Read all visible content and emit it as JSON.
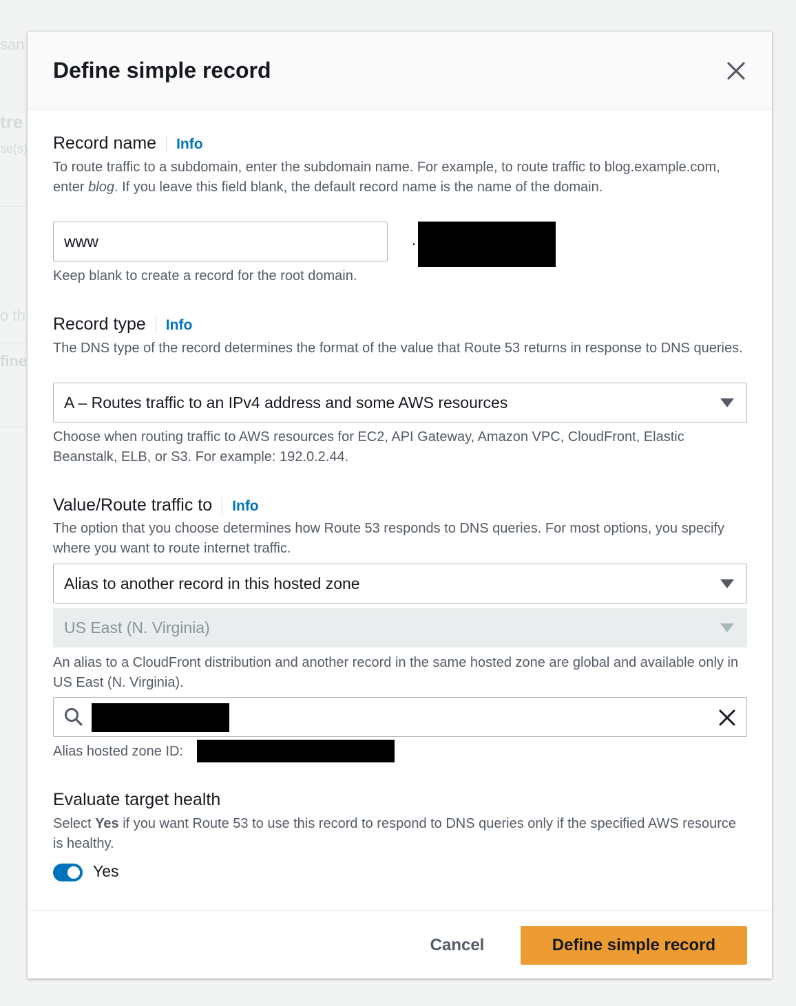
{
  "background": {
    "fragments": [
      "san",
      "tre",
      "se(s)",
      "o th",
      "fine"
    ]
  },
  "modal": {
    "title": "Define simple record",
    "close_icon": "close-icon"
  },
  "record_name": {
    "label": "Record name",
    "info": "Info",
    "description_part1": "To route traffic to a subdomain, enter the subdomain name. For example, to route traffic to blog.example.com, enter ",
    "description_em": "blog",
    "description_part2": ". If you leave this field blank, the default record name is the name of the domain.",
    "value": "www",
    "separator": ".",
    "hint": "Keep blank to create a record for the root domain."
  },
  "record_type": {
    "label": "Record type",
    "info": "Info",
    "description": "The DNS type of the record determines the format of the value that Route 53 returns in response to DNS queries.",
    "selected": "A – Routes traffic to an IPv4 address and some AWS resources",
    "hint": "Choose when routing traffic to AWS resources for EC2, API Gateway, Amazon VPC, CloudFront, Elastic Beanstalk, ELB, or S3. For example: 192.0.2.44."
  },
  "value_route": {
    "label": "Value/Route traffic to",
    "info": "Info",
    "description": "The option that you choose determines how Route 53 responds to DNS queries. For most options, you specify where you want to route internet traffic.",
    "endpoint_selected": "Alias to another record in this hosted zone",
    "region_selected": "US East (N. Virginia)",
    "region_hint": "An alias to a CloudFront distribution and another record in the same hosted zone are global and available only in US East (N. Virginia).",
    "search_icon": "search-icon",
    "alias_zone_label": "Alias hosted zone ID:"
  },
  "evaluate_health": {
    "label": "Evaluate target health",
    "description_pre": "Select ",
    "description_bold": "Yes",
    "description_post": " if you want Route 53 to use this record to respond to DNS queries only if the specified AWS resource is healthy.",
    "toggle_label": "Yes",
    "enabled": true
  },
  "footer": {
    "cancel_label": "Cancel",
    "submit_label": "Define simple record"
  },
  "colors": {
    "link": "#0073bb",
    "primary_button": "#ec9c32",
    "toggle_on": "#0073bb",
    "header_bg": "#fafafa"
  }
}
